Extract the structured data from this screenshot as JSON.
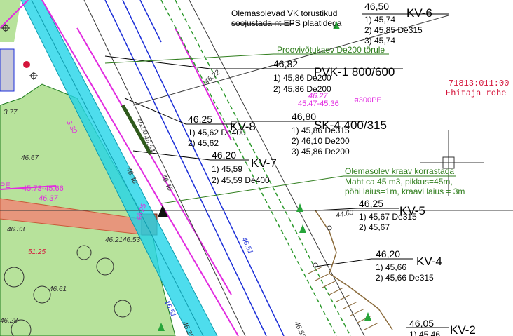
{
  "wells": {
    "kv6": {
      "name": "KV-6",
      "top": "46,50",
      "l1": "1) 45,74",
      "l2": "2) 45,85 De315",
      "l3": "3) 45,74"
    },
    "pvk1": {
      "name": "PVK-1 800/600",
      "top": "46,82",
      "l1": "1) 45,86 De200",
      "l2": "2) 45,86 De200"
    },
    "kv8": {
      "name": "KV-8",
      "top": "46,25",
      "l1": "1) 45,62 De400",
      "l2": "2) 45,62"
    },
    "sk4": {
      "name": "SK-4 400/315",
      "top": "46,80",
      "l1": "1) 45,86 De315",
      "l2": "2) 46,10 De200",
      "l3": "3) 45,86 De200"
    },
    "kv7": {
      "name": "KV-7",
      "top": "46,20",
      "l1": "1) 45,59",
      "l2": "2) 45,59 De400"
    },
    "kv5": {
      "name": "KV-5",
      "top": "46,25",
      "l1": "1) 45,67 De315",
      "l2": "2) 45,67"
    },
    "kv4": {
      "name": "KV-4",
      "top": "46,20",
      "l1": "1) 45,66",
      "l2": "2) 45,66 De315"
    },
    "kv2": {
      "name": "KV-2",
      "top": "46,05",
      "l1": "1) 45,46"
    }
  },
  "notes": {
    "existing_pipe_1": "Olemasolevad VK torustikud",
    "existing_pipe_2": "soojustada nt EPS plaatidega",
    "test_well": "Proovivõtukaev De200 tõrule",
    "ditch_1": "Olemasolev kraav korrastada",
    "ditch_2": "Maht ca 45 m3, pikkus=45m,",
    "ditch_3": "põhi laius=1m, kraavi laius = 3m"
  },
  "cadastre": {
    "number": "71813:011:00",
    "owner": "Ehitaja rohe"
  },
  "pipe_tags": {
    "pe_main": "ø300PE",
    "pe_elev": "46.27",
    "pe_range": "45.47-45.36",
    "left_elev": "46.37",
    "left_range": "45.73-45.66",
    "left_pe": "PE"
  },
  "spot_heights": [
    "46.67",
    "46.33",
    "51.25",
    "46.21",
    "46.53",
    "46.61",
    "46.28",
    "46.54",
    "46.46",
    "46.48",
    "46.51",
    "46.58",
    "44.60",
    "46.25",
    "16.51",
    "46.28",
    "3.77",
    "3.30",
    "46.00",
    "46.22"
  ],
  "colors": {
    "magenta": "#e22be0",
    "cyan": "#22d4e8",
    "green_area": "#b7e29b",
    "blue_line": "#1c2fd8",
    "salmon_road": "#e7967c",
    "dark_green": "#2f7d1c",
    "red_text": "#d4143a"
  }
}
